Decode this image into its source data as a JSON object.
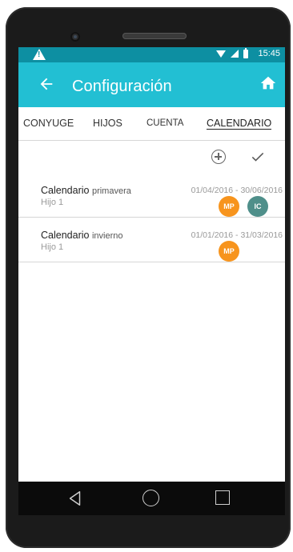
{
  "status_bar": {
    "time": "15:45",
    "icons": [
      "warning-icon",
      "wifi-icon",
      "signal-icon",
      "battery-icon"
    ]
  },
  "app_bar": {
    "title": "Configuración",
    "back_icon": "arrow-left-icon",
    "home_icon": "home-icon",
    "color": "#22bfd3"
  },
  "tabs": [
    {
      "label": "CONYUGE"
    },
    {
      "label": "HIJOS"
    },
    {
      "label": "CUENTA"
    },
    {
      "label": "CALENDARIO",
      "active": true
    }
  ],
  "actions": [
    "add-circle-icon",
    "check-icon"
  ],
  "calendars": [
    {
      "name": "Calendario",
      "season": "primavera",
      "child": "Hijo 1",
      "dates": "01/04/2016 - 30/06/2016",
      "avatars": [
        {
          "initials": "MP",
          "color": "#f7941d"
        },
        {
          "initials": "IC",
          "color": "#4f8f8a"
        }
      ]
    },
    {
      "name": "Calendario",
      "season": "invierno",
      "child": "Hijo 1",
      "dates": "01/01/2016 - 31/03/2016",
      "avatars": [
        {
          "initials": "MP",
          "color": "#f7941d"
        }
      ]
    }
  ],
  "nav_bar": [
    "back-triangle-icon",
    "home-circle-icon",
    "recents-square-icon"
  ]
}
